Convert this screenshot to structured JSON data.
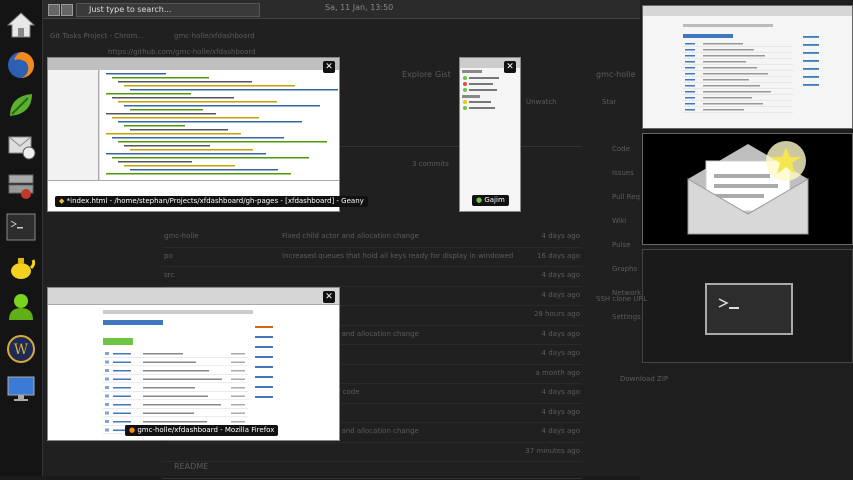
{
  "panel": {
    "search_placeholder": "Just type to search...",
    "clock": "Sa, 11 Jan, 13:50"
  },
  "dock": {
    "items": [
      {
        "icon": "home-icon"
      },
      {
        "icon": "firefox-icon"
      },
      {
        "icon": "leaf-app-icon"
      },
      {
        "icon": "mail-sync-icon"
      },
      {
        "icon": "network-tools-icon"
      },
      {
        "icon": "terminal-icon"
      },
      {
        "icon": "teapot-icon"
      },
      {
        "icon": "user-icon"
      },
      {
        "icon": "warcraft-icon"
      },
      {
        "icon": "display-icon"
      }
    ]
  },
  "background_browser": {
    "tab1": "Git Tasks Project - Chrom...",
    "tab2": "gmc-holle/xfdashboard",
    "url": "https://github.com/gmc-holle/xfdashboard",
    "nav": [
      "Explore",
      "Gist"
    ],
    "user": "gmc-holle",
    "watch": "Unwatch",
    "star": "Star",
    "sidebar": [
      "Code",
      "Issues",
      "Pull Req",
      "Wiki",
      "Pulse",
      "Graphs",
      "Network",
      "Settings"
    ],
    "clone_label": "SSH clone URL",
    "download": "Download ZIP",
    "readme": "README",
    "commits": "3 commits",
    "commit_rows": [
      {
        "name": "gmc-holle",
        "msg": "Fixed child actor and allocation change",
        "time": "4 days ago"
      },
      {
        "name": "po",
        "msg": "Increased queues that hold all keys ready for display in windowed",
        "time": "16 days ago"
      },
      {
        "name": "src",
        "msg": "",
        "time": "4 days ago"
      },
      {
        "name": "",
        "msg": "",
        "time": "4 days ago"
      },
      {
        "name": "",
        "msg": "",
        "time": "28 hours ago"
      },
      {
        "name": "",
        "msg": "Fixed child actor and allocation change",
        "time": "4 days ago"
      },
      {
        "name": "",
        "msg": "",
        "time": "4 days ago"
      },
      {
        "name": "",
        "msg": "",
        "time": "a month ago"
      },
      {
        "name": "",
        "msg": "Removed part of code",
        "time": "4 days ago"
      },
      {
        "name": "",
        "msg": "",
        "time": "4 days ago"
      },
      {
        "name": "",
        "msg": "Fixed child actor and allocation change",
        "time": "4 days ago"
      },
      {
        "name": "",
        "msg": "",
        "time": "37 minutes ago"
      }
    ]
  },
  "windows": {
    "geany": {
      "caption": "*index.html - /home/stephan/Projects/xfdashboard/gh-pages - [xfdashboard] - Geany",
      "close": "✕"
    },
    "gajim": {
      "caption": "Gajim",
      "close": "✕"
    },
    "firefox": {
      "caption": "gmc-holle/xfdashboard - Mozilla Firefox",
      "close": "✕"
    }
  },
  "colors": {
    "accent_green": "#6cc644",
    "panel_bg": "#2b2b2b",
    "dock_bg": "#141414"
  }
}
